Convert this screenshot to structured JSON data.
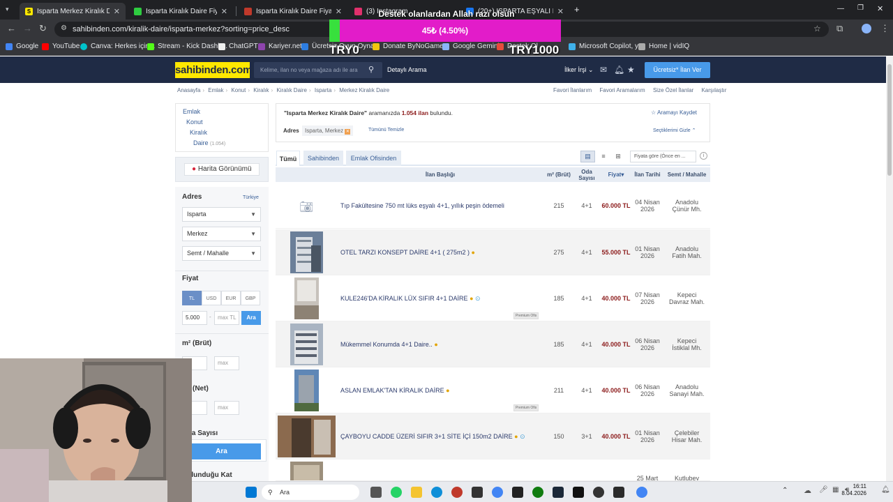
{
  "browser": {
    "tabs": [
      {
        "title": "Isparta Merkez Kiralık Daire Fiyatları",
        "active": true
      },
      {
        "title": "Isparta Kiralık Daire Fiyatları ve",
        "active": false
      },
      {
        "title": "Isparta Kiralık Daire Fiyatları ve",
        "active": false
      },
      {
        "title": "(3) Instagram",
        "active": false
      },
      {
        "title": "(20+) ISPARTA EŞYALI EŞYASIZ",
        "active": false
      }
    ],
    "url": "sahibinden.com/kiralik-daire/isparta-merkez?sorting=price_desc",
    "bookmarks": [
      "Google",
      "YouTube",
      "Canva: Herkes için...",
      "Stream - Kick Dashb...",
      "ChatGPT",
      "Kariyer.net",
      "Ücretsiz Oyun Oyna...",
      "Donate ByNoGame...",
      "Google Gemini",
      "Destek Ol",
      "Microsoft Copilot, y...",
      "Home | vidIQ"
    ]
  },
  "donation": {
    "title": "Destek olanlardan Allah razı olsun",
    "value": "45₺ (4.50%)",
    "progress": 0.045,
    "min_label": "TRY0",
    "max_label": "TRY1000"
  },
  "site": {
    "logo": "sahibinden.com",
    "search_placeholder": "Kelime, ilan no veya mağaza adı ile ara",
    "detailed_search": "Detaylı Arama",
    "user": "İlker İrşi",
    "post_ad": "Ücretsiz* İlan Ver"
  },
  "breadcrumb": [
    "Anasayfa",
    "Emlak",
    "Konut",
    "Kiralık",
    "Kiralık Daire",
    "Isparta",
    "Merkez Kiralık Daire"
  ],
  "toplinks": [
    "Favori İlanlarım",
    "Favori Aramalarım",
    "Size Özel İlanlar",
    "Karşılaştır"
  ],
  "sidebar": {
    "categories": [
      {
        "label": "Emlak"
      },
      {
        "label": "Konut"
      },
      {
        "label": "Kiralık"
      },
      {
        "label": "Daire",
        "count": "(1.054)"
      }
    ],
    "map_button": "Harita Görünümü",
    "address_title": "Adres",
    "country_link": "Türkiye",
    "address_selects": [
      "Isparta",
      "Merkez",
      "Semt / Mahalle"
    ],
    "price_title": "Fiyat",
    "currencies": [
      "TL",
      "USD",
      "EUR",
      "GBP"
    ],
    "price_min": "5.000",
    "price_max_placeholder": "max TL",
    "search_btn": "Ara",
    "m2_brut_title": "m² (Brüt)",
    "m2_net_title": "m² (Net)",
    "max_placeholder": "max",
    "room_title": "Oda Sayısı",
    "floor_title": "Bulunduğu Kat",
    "big_search": "Ara"
  },
  "results": {
    "query": "\"Isparta Merkez Kiralık Daire\"",
    "query_suffix": "aramanızda",
    "count": "1.054 ilan",
    "found": "bulundu.",
    "save_search": "Aramayı Kaydet",
    "address_label": "Adres",
    "address_chip": "Isparta, Merkez",
    "clear_all": "Tümünü Temizle",
    "hide_selected": "Seçtiklerimi Gizle",
    "tabs": [
      "Tümü",
      "Sahibinden",
      "Emlak Ofisinden"
    ],
    "sort": "Fiyata göre (Önce en ...",
    "columns": [
      "İlan Başlığı",
      "m² (Brüt)",
      "Oda Sayısı",
      "Fiyat",
      "İlan Tarihi",
      "Semt / Mahalle"
    ],
    "premium_label": "Premium Ofis",
    "rows": [
      {
        "title": "Tıp Fakültesine 750 mt lüks eşyalı 4+1, yıllık peşin ödemeli",
        "m2": "215",
        "rooms": "4+1",
        "price": "60.000 TL",
        "date1": "04 Nisan",
        "date2": "2026",
        "area1": "Anadolu",
        "area2": "Çünür Mh."
      },
      {
        "title": "OTEL TARZI KONSEPT DAİRE 4+1 ( 275m2 )",
        "m2": "275",
        "rooms": "4+1",
        "price": "55.000 TL",
        "date1": "01 Nisan",
        "date2": "2026",
        "area1": "Anadolu",
        "area2": "Fatih Mah."
      },
      {
        "title": "KULE246'DA KİRALIK LÜX SIFIR 4+1 DAİRE",
        "m2": "185",
        "rooms": "4+1",
        "price": "40.000 TL",
        "date1": "07 Nisan",
        "date2": "2026",
        "area1": "Kepeci",
        "area2": "Davraz Mah."
      },
      {
        "title": "Mükemmel Konumda 4+1 Daire..",
        "m2": "185",
        "rooms": "4+1",
        "price": "40.000 TL",
        "date1": "06 Nisan",
        "date2": "2026",
        "area1": "Kepeci",
        "area2": "İstiklal Mh."
      },
      {
        "title": "ASLAN EMLAK'TAN KİRALIK DAİRE",
        "m2": "211",
        "rooms": "4+1",
        "price": "40.000 TL",
        "date1": "06 Nisan",
        "date2": "2026",
        "area1": "Anadolu",
        "area2": "Sanayi Mah."
      },
      {
        "title": "ÇAYBOYU CADDE ÜZERİ SIFIR 3+1 SİTE İÇİ 150m2 DAİRE",
        "m2": "150",
        "rooms": "3+1",
        "price": "40.000 TL",
        "date1": "01 Nisan",
        "date2": "2026",
        "area1": "Çelebiler",
        "area2": "Hisar Mah."
      },
      {
        "title": "",
        "m2": "",
        "rooms": "",
        "price": "",
        "date1": "25 Mart",
        "date2": "",
        "area1": "Kutlubey",
        "area2": ""
      }
    ]
  },
  "taskbar": {
    "search": "Ara",
    "time": "16:11",
    "date": "8.04.2026"
  },
  "colors": {
    "header": "#1f2b45",
    "logo_bg": "#ffe800",
    "accent_blue": "#489ae9",
    "price_red": "#8b1a1a",
    "donation_bg": "#e21cc9",
    "donation_fill": "#38e03d"
  }
}
